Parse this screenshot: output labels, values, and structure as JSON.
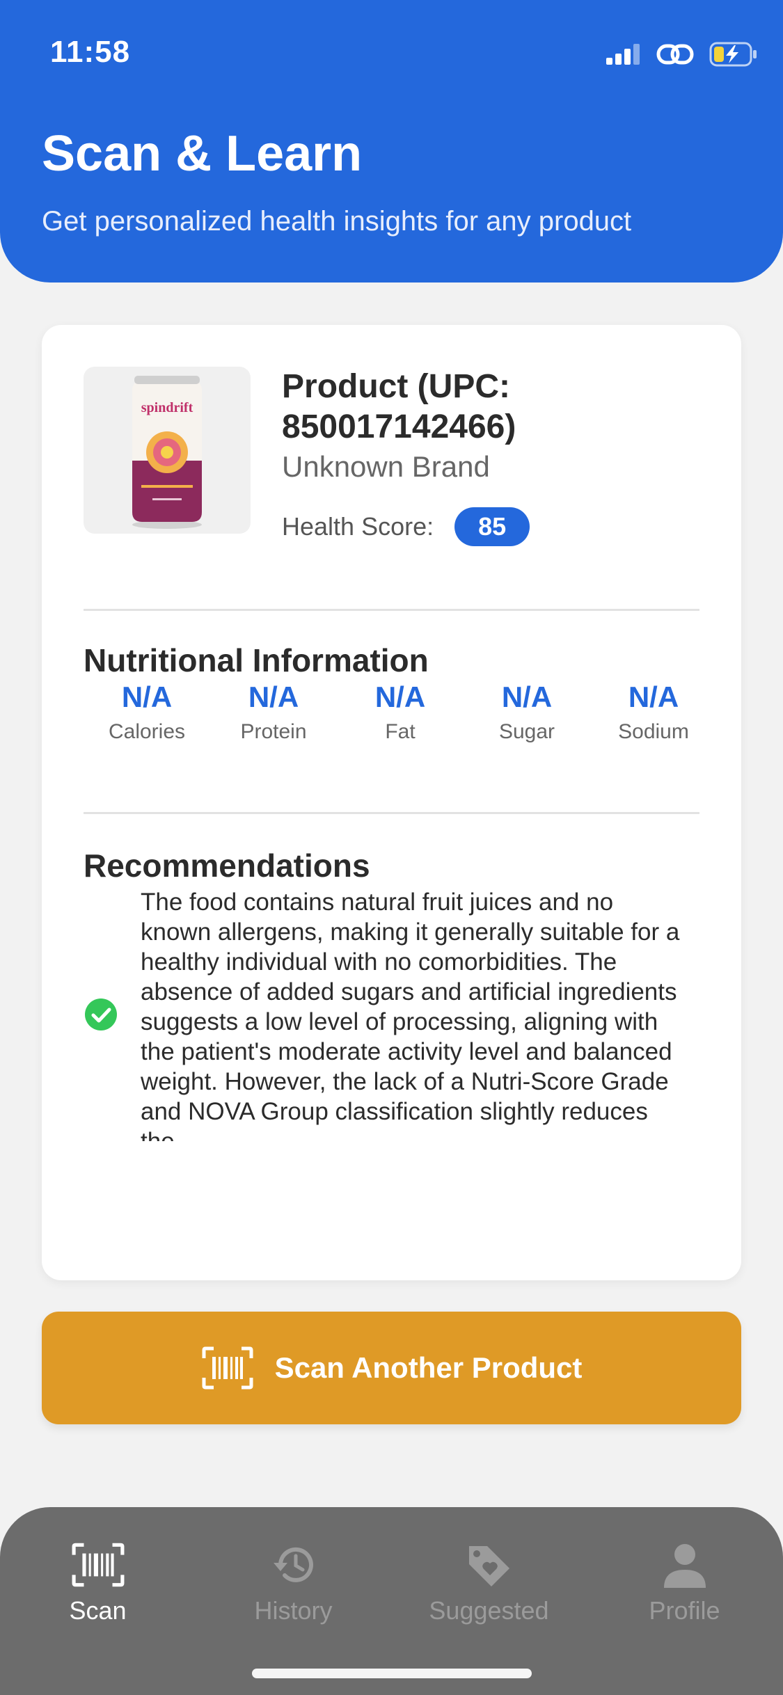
{
  "status_bar": {
    "time": "11:58",
    "icons": [
      "signal-icon",
      "link-icon",
      "battery-charging-icon"
    ]
  },
  "header": {
    "title": "Scan & Learn",
    "subtitle": "Get personalized health insights for any product",
    "background_color": "#2468dc"
  },
  "product": {
    "name": "Product (UPC: 850017142466)",
    "brand": "Unknown Brand",
    "health_score_label": "Health Score:",
    "health_score": "85",
    "image_icon": "sparkling-water-can-image"
  },
  "nutrition": {
    "title": "Nutritional Information",
    "items": [
      {
        "value": "N/A",
        "label": "Calories"
      },
      {
        "value": "N/A",
        "label": "Protein"
      },
      {
        "value": "N/A",
        "label": "Fat"
      },
      {
        "value": "N/A",
        "label": "Sugar"
      },
      {
        "value": "N/A",
        "label": "Sodium"
      }
    ]
  },
  "recommendations": {
    "title": "Recommendations",
    "icon": "check-circle-icon",
    "text": "The food contains natural fruit juices and no known allergens, making it generally suitable for a healthy individual with no comorbidities. The absence of added sugars and artificial ingredients suggests a low level of processing, aligning with the patient's moderate activity level and balanced weight. However, the lack of a Nutri-Score Grade and NOVA Group classification slightly reduces the"
  },
  "scan_button": {
    "label": "Scan Another Product",
    "icon": "barcode-scan-icon",
    "color": "#df9a26"
  },
  "tabs": [
    {
      "label": "Scan",
      "icon": "barcode-scan-icon",
      "active": true
    },
    {
      "label": "History",
      "icon": "history-icon",
      "active": false
    },
    {
      "label": "Suggested",
      "icon": "tag-heart-icon",
      "active": false
    },
    {
      "label": "Profile",
      "icon": "person-icon",
      "active": false
    }
  ]
}
